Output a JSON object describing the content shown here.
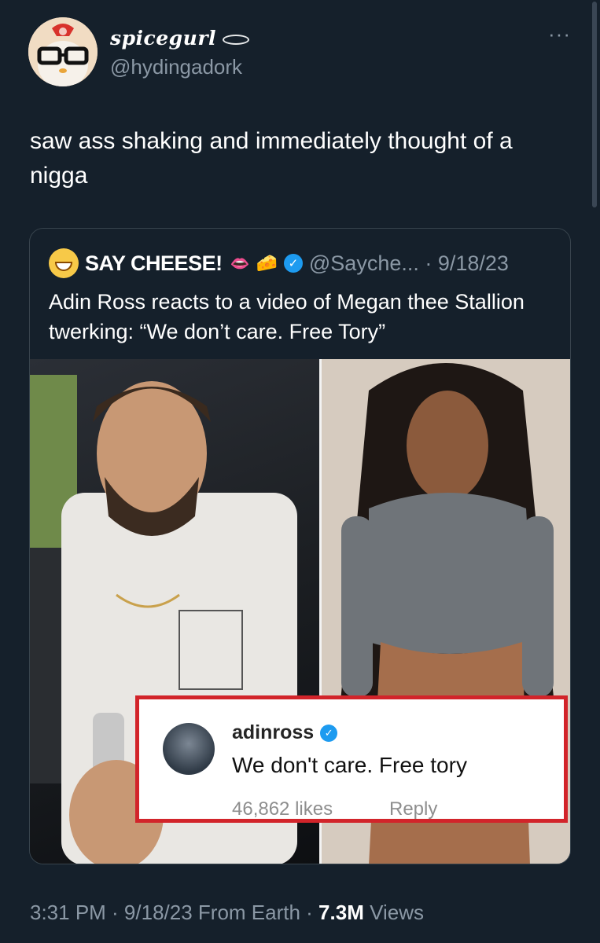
{
  "tweet": {
    "display_name": "spicegurl",
    "handle": "@hydingadork",
    "more_label": "···",
    "text": "saw ass shaking and immediately thought of a nigga",
    "timestamp": "3:31 PM · 9/18/23 From Earth · ",
    "views_count": "7.3M",
    "views_label": " Views"
  },
  "quote": {
    "name": "SAY CHEESE!",
    "lips_icon": "👄",
    "cheese_icon": "🧀",
    "verified_icon": "✓",
    "handle_date": "@Sayche... · 9/18/23",
    "text": "Adin Ross reacts to a video of Megan thee Stallion twerking: “We don’t care. Free Tory”"
  },
  "comment": {
    "username": "adinross",
    "verified_icon": "✓",
    "text": "We don't care. Free tory",
    "likes": "46,862 likes",
    "reply": "Reply"
  },
  "colors": {
    "background": "#15202b",
    "secondary_text": "#8b98a5",
    "verified_blue": "#1d9bf0",
    "highlight_red": "#d2242a"
  }
}
